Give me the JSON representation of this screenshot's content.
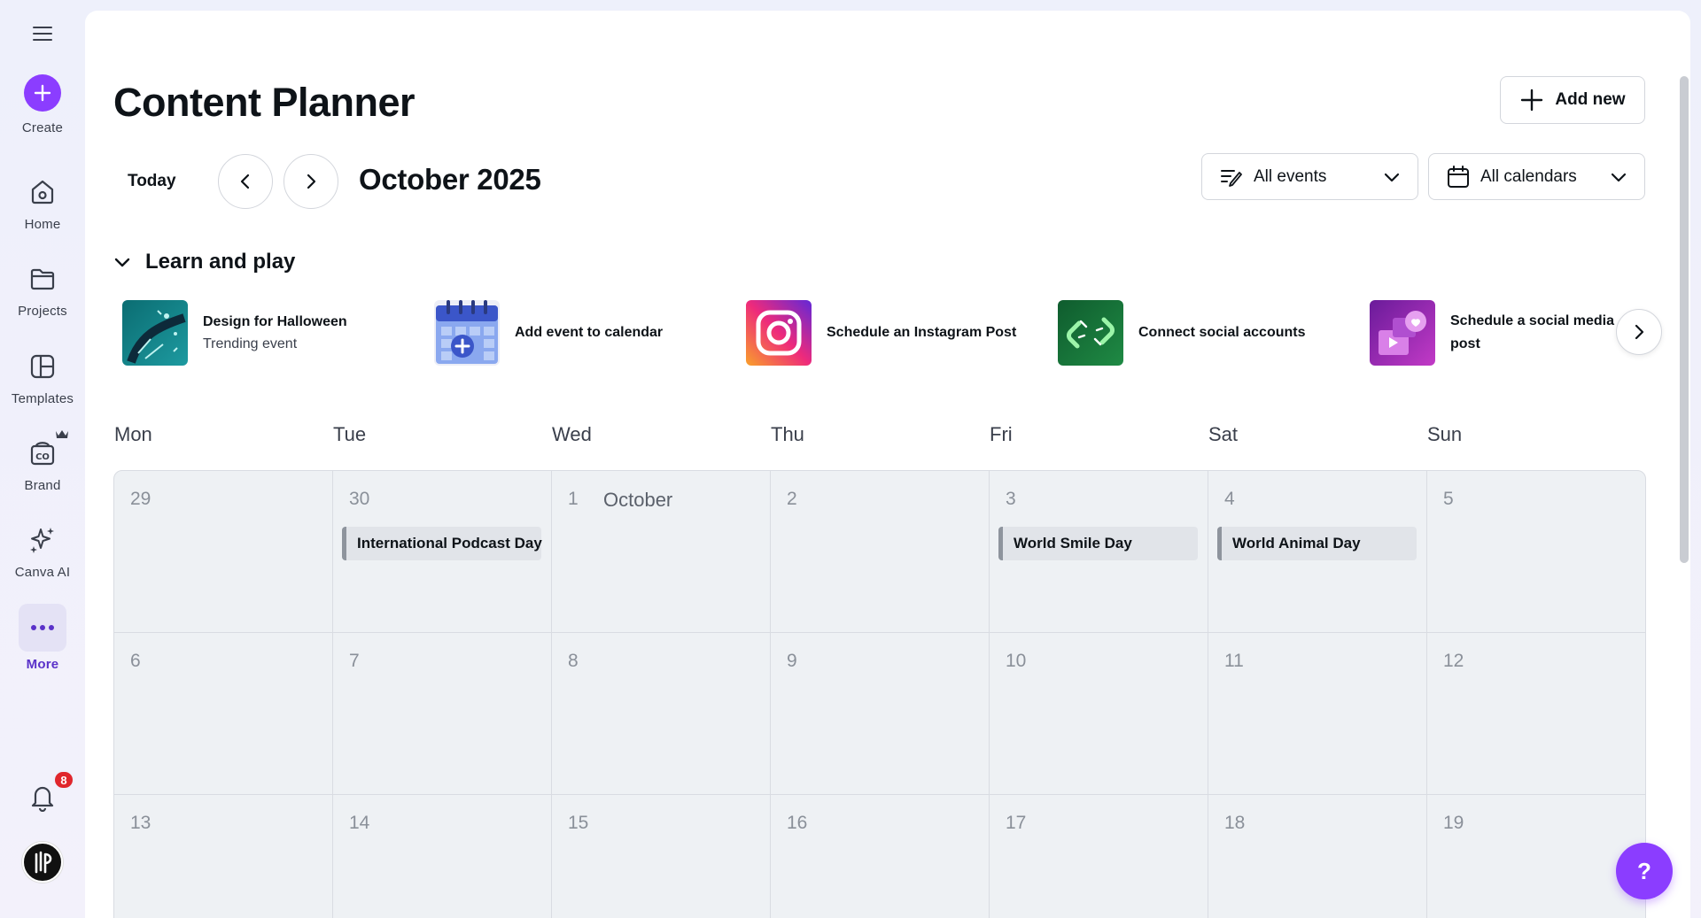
{
  "sidebar": {
    "create_label": "Create",
    "items": [
      {
        "label": "Home",
        "icon": "home-icon"
      },
      {
        "label": "Projects",
        "icon": "folder-icon"
      },
      {
        "label": "Templates",
        "icon": "templates-icon"
      },
      {
        "label": "Brand",
        "icon": "brand-icon"
      },
      {
        "label": "Canva AI",
        "icon": "sparkle-icon"
      },
      {
        "label": "More",
        "icon": "more-dots-icon"
      }
    ],
    "notifications_count": "8"
  },
  "header": {
    "title": "Content Planner",
    "add_new_label": "Add new"
  },
  "toolbar": {
    "today_label": "Today",
    "month_label": "October 2025",
    "events_filter": "All events",
    "calendars_filter": "All calendars"
  },
  "learn": {
    "section_title": "Learn and play",
    "cards": [
      {
        "title": "Design for Halloween",
        "subtitle": "Trending event"
      },
      {
        "title": "Add event to calendar",
        "subtitle": ""
      },
      {
        "title": "Schedule an Instagram Post",
        "subtitle": ""
      },
      {
        "title": "Connect social accounts",
        "subtitle": ""
      },
      {
        "title": "Schedule a social media",
        "title2": "post",
        "subtitle": ""
      }
    ]
  },
  "calendar": {
    "weekdays": [
      "Mon",
      "Tue",
      "Wed",
      "Thu",
      "Fri",
      "Sat",
      "Sun"
    ],
    "weeks": [
      [
        {
          "day": "29",
          "month": "",
          "event": ""
        },
        {
          "day": "30",
          "month": "",
          "event": "International Podcast Day"
        },
        {
          "day": "1",
          "month": "October",
          "event": ""
        },
        {
          "day": "2",
          "month": "",
          "event": ""
        },
        {
          "day": "3",
          "month": "",
          "event": "World Smile Day"
        },
        {
          "day": "4",
          "month": "",
          "event": "World Animal Day"
        },
        {
          "day": "5",
          "month": "",
          "event": ""
        }
      ],
      [
        {
          "day": "6"
        },
        {
          "day": "7"
        },
        {
          "day": "8"
        },
        {
          "day": "9"
        },
        {
          "day": "10"
        },
        {
          "day": "11"
        },
        {
          "day": "12"
        }
      ],
      [
        {
          "day": "13"
        },
        {
          "day": "14"
        },
        {
          "day": "15"
        },
        {
          "day": "16"
        },
        {
          "day": "17"
        },
        {
          "day": "18"
        },
        {
          "day": "19"
        }
      ]
    ]
  },
  "help_label": "?",
  "colors": {
    "accent": "#8b3dff",
    "badge": "#e0262c",
    "event_bar": "#8e949d",
    "grid_bg": "#eef1f4"
  }
}
